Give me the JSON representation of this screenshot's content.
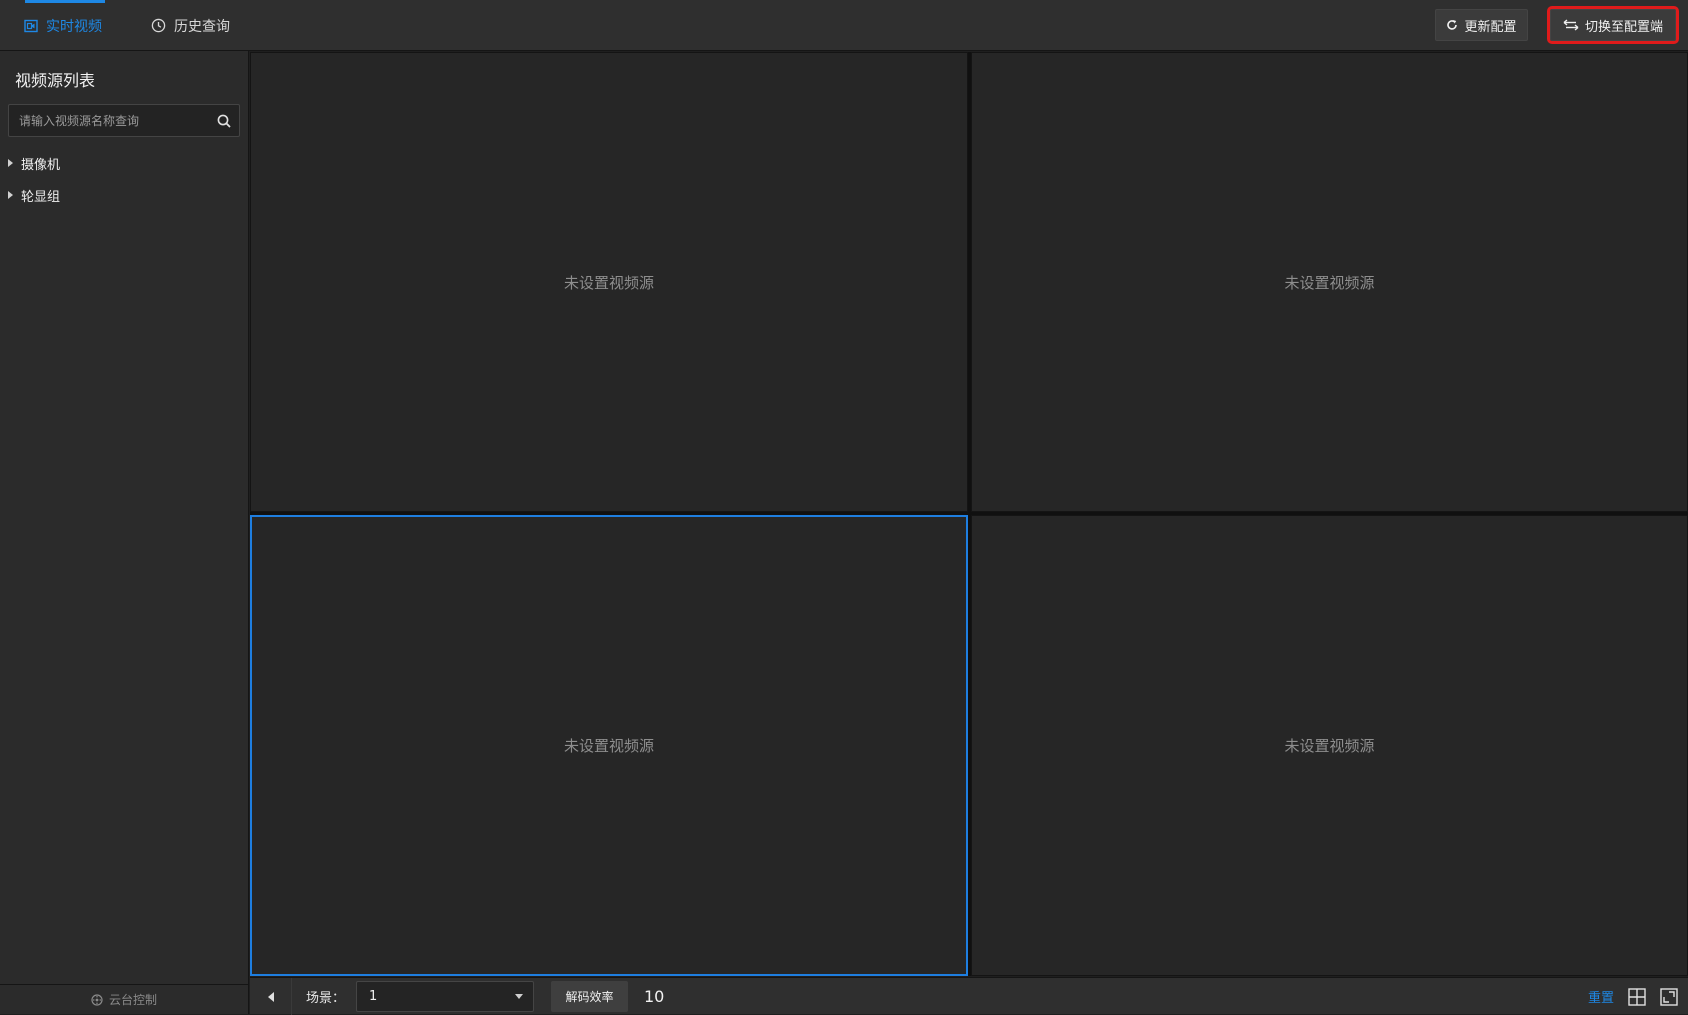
{
  "header": {
    "tabs": [
      {
        "label": "实时视频",
        "active": true,
        "icon": "live-video-icon"
      },
      {
        "label": "历史查询",
        "active": false,
        "icon": "clock-icon"
      }
    ],
    "update_config_label": "更新配置",
    "switch_config_label": "切换至配置端"
  },
  "sidebar": {
    "title": "视频源列表",
    "search_placeholder": "请输入视频源名称查询",
    "tree": [
      {
        "label": "摄像机"
      },
      {
        "label": "轮显组"
      }
    ],
    "ptz_label": "云台控制"
  },
  "grid": {
    "cells": [
      {
        "text": "未设置视频源",
        "selected": false
      },
      {
        "text": "未设置视频源",
        "selected": false
      },
      {
        "text": "未设置视频源",
        "selected": true
      },
      {
        "text": "未设置视频源",
        "selected": false
      }
    ]
  },
  "toolbar": {
    "scene_label": "场景：",
    "scene_value": "1",
    "decode_label": "解码效率",
    "decode_value": "10",
    "reset_label": "重置"
  },
  "colors": {
    "accent": "#1e88e5",
    "highlight_box": "#e01b1b",
    "background": "#1f1f1f"
  }
}
